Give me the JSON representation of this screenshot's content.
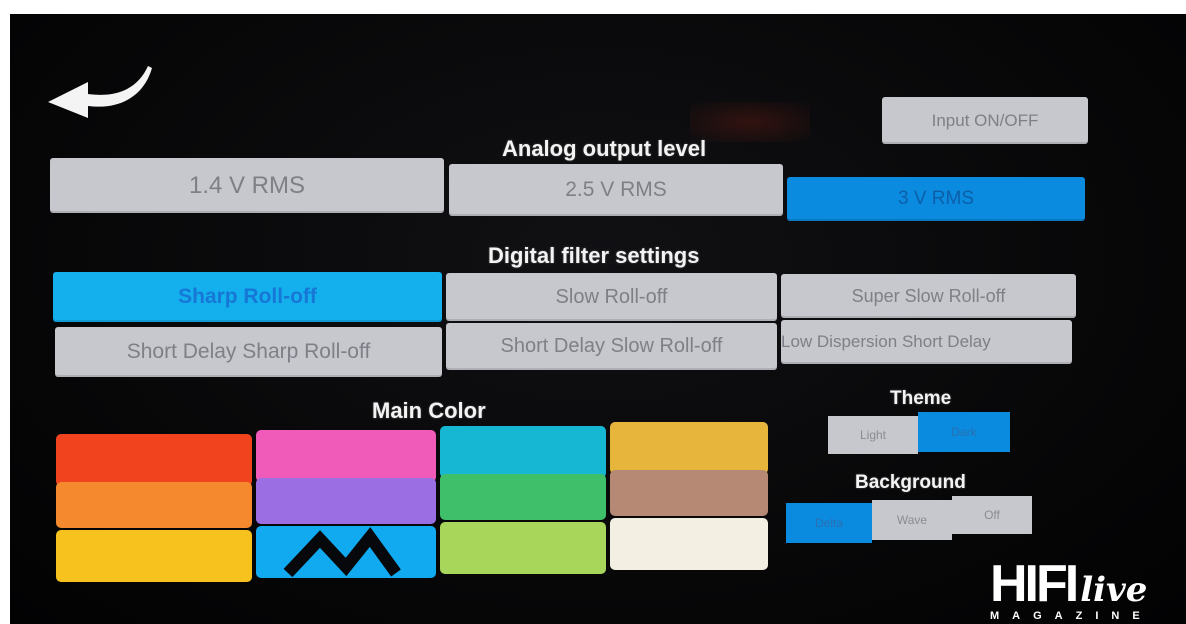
{
  "header": {
    "input_toggle_label": "Input ON/OFF"
  },
  "analog_output": {
    "title": "Analog output level",
    "options": [
      "1.4 V RMS",
      "2.5 V RMS",
      "3 V RMS"
    ],
    "selected": "3 V RMS"
  },
  "digital_filter": {
    "title": "Digital filter settings",
    "options": [
      "Sharp Roll-off",
      "Slow Roll-off",
      "Super Slow Roll-off",
      "Short Delay Sharp Roll-off",
      "Short Delay Slow Roll-off",
      "Low Dispersion Short Delay"
    ],
    "selected": "Sharp Roll-off"
  },
  "main_color": {
    "title": "Main Color",
    "swatches": [
      "#f2431f",
      "#f05ab8",
      "#16b7d3",
      "#e7b53c",
      "#f4892e",
      "#9b6fe3",
      "#3fbf6a",
      "#b58973",
      "#f7c21d",
      "#11a9f0",
      "#a8d65a",
      "#f3efe2"
    ],
    "selected_swatch": "#11a9f0"
  },
  "theme": {
    "title": "Theme",
    "options": [
      "Light",
      "Dark"
    ],
    "selected": "Dark"
  },
  "background": {
    "title": "Background",
    "options": [
      "Delta",
      "Wave",
      "Off"
    ],
    "selected": "Delta"
  },
  "watermark": {
    "brand": "HIFI",
    "brand_script": "live",
    "tagline": "MAGAZINE"
  },
  "colors": {
    "accent_blue": "#0a8be0",
    "accent_cyan": "#14b0ee",
    "button_gray": "#c7c8cd"
  }
}
